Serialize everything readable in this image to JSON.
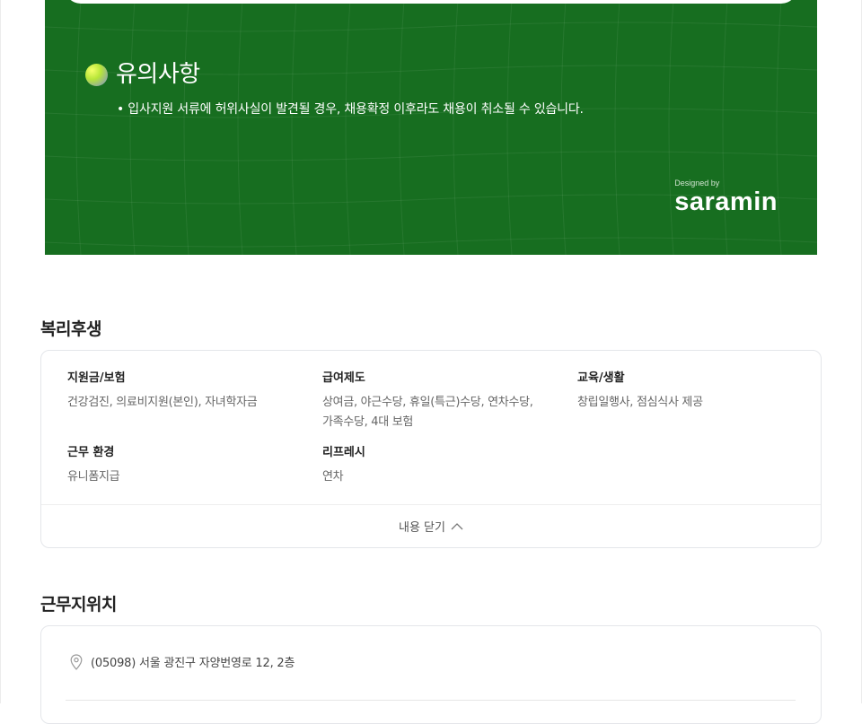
{
  "notice": {
    "title": "유의사항",
    "text": "• 입사지원 서류에 허위사실이 발견될 경우, 채용확정 이후라도 채용이 취소될 수 있습니다.",
    "credit_small": "Designed by",
    "credit_logo": "saramin",
    "colors": {
      "background": "#176e20"
    }
  },
  "benefits": {
    "title": "복리후생",
    "groups": [
      {
        "head": "지원금/보험",
        "body": "건강검진, 의료비지원(본인), 자녀학자금"
      },
      {
        "head": "급여제도",
        "body": "상여금, 야근수당, 휴일(특근)수당, 연차수당, 가족수당, 4대 보험"
      },
      {
        "head": "교육/생활",
        "body": "창립일행사, 점심식사 제공"
      },
      {
        "head": "근무 환경",
        "body": "유니폼지급"
      },
      {
        "head": "리프레시",
        "body": "연차"
      }
    ],
    "collapse_label": "내용 닫기",
    "collapse_icon": "chevron-up-icon"
  },
  "location": {
    "title": "근무지위치",
    "address": "(05098) 서울 광진구 자양번영로 12, 2층",
    "pin_icon": "map-pin-icon"
  }
}
